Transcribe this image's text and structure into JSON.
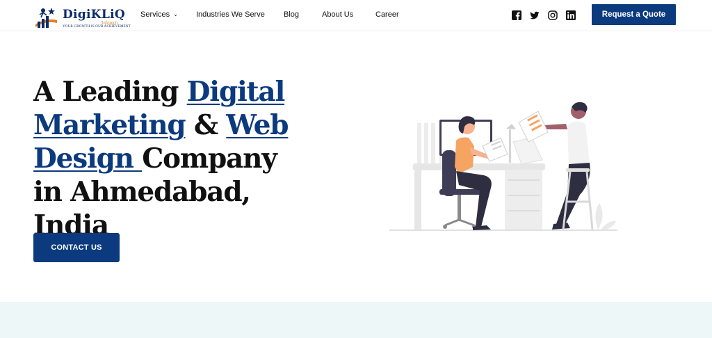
{
  "brand": {
    "name": "DigiKLiQ",
    "subtitle": "Infotech",
    "tagline": "YOUR GROWTH IS OUR ACHIEVEMENT"
  },
  "nav": {
    "items": [
      {
        "label": "Services",
        "has_dropdown": true
      },
      {
        "label": "Industries We Serve"
      },
      {
        "label": "Blog"
      },
      {
        "label": "About Us"
      },
      {
        "label": "Career"
      }
    ]
  },
  "social": {
    "icons": [
      "facebook-icon",
      "twitter-icon",
      "instagram-icon",
      "linkedin-icon"
    ]
  },
  "header": {
    "cta_label": "Request a Quote"
  },
  "hero": {
    "title_parts": [
      {
        "text": "A Leading ",
        "highlight": false
      },
      {
        "text": "Digital Marketing",
        "highlight": true
      },
      {
        "text": " & ",
        "highlight": false
      },
      {
        "text": "Web Design ",
        "highlight": true
      },
      {
        "text": "Company in Ahmedabad, India",
        "highlight": false
      }
    ],
    "cta_label": "CONTACT US"
  },
  "colors": {
    "primary": "#0b3a7e",
    "accent": "#f5a462",
    "band": "#eef7f7"
  }
}
